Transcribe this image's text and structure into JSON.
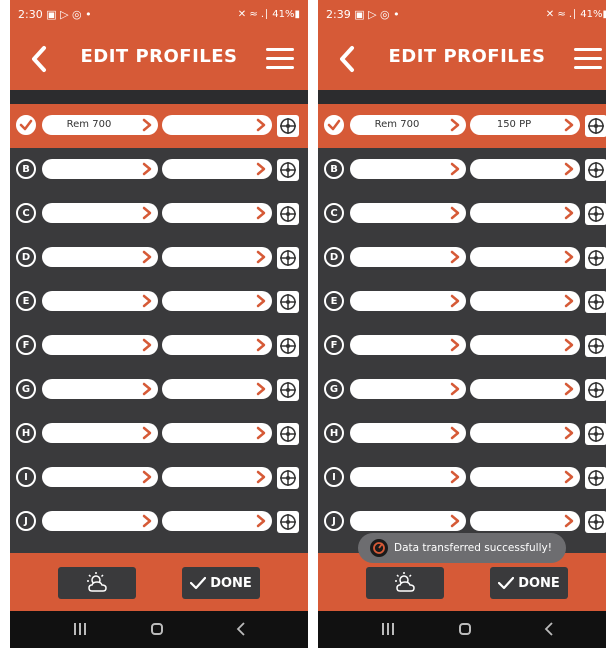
{
  "screens": [
    {
      "status_time": "2:30",
      "status_icons": "▣ ▷ ◎ •",
      "status_right": "✕ ≈ .∣ 41%▮",
      "title": "EDIT PROFILES",
      "rows": [
        {
          "badge": "",
          "selected": true,
          "field1": "Rem 700",
          "field2": ""
        },
        {
          "badge": "B",
          "selected": false,
          "field1": "",
          "field2": ""
        },
        {
          "badge": "C",
          "selected": false,
          "field1": "",
          "field2": ""
        },
        {
          "badge": "D",
          "selected": false,
          "field1": "",
          "field2": ""
        },
        {
          "badge": "E",
          "selected": false,
          "field1": "",
          "field2": ""
        },
        {
          "badge": "F",
          "selected": false,
          "field1": "",
          "field2": ""
        },
        {
          "badge": "G",
          "selected": false,
          "field1": "",
          "field2": ""
        },
        {
          "badge": "H",
          "selected": false,
          "field1": "",
          "field2": ""
        },
        {
          "badge": "I",
          "selected": false,
          "field1": "",
          "field2": ""
        },
        {
          "badge": "J",
          "selected": false,
          "field1": "",
          "field2": ""
        }
      ],
      "done_label": "DONE",
      "toast": null
    },
    {
      "status_time": "2:39",
      "status_icons": "▣ ▷ ◎ •",
      "status_right": "✕ ≈ .∣ 41%▮",
      "title": "EDIT PROFILES",
      "rows": [
        {
          "badge": "",
          "selected": true,
          "field1": "Rem 700",
          "field2": "150 PP"
        },
        {
          "badge": "B",
          "selected": false,
          "field1": "",
          "field2": ""
        },
        {
          "badge": "C",
          "selected": false,
          "field1": "",
          "field2": ""
        },
        {
          "badge": "D",
          "selected": false,
          "field1": "",
          "field2": ""
        },
        {
          "badge": "E",
          "selected": false,
          "field1": "",
          "field2": ""
        },
        {
          "badge": "F",
          "selected": false,
          "field1": "",
          "field2": ""
        },
        {
          "badge": "G",
          "selected": false,
          "field1": "",
          "field2": ""
        },
        {
          "badge": "H",
          "selected": false,
          "field1": "",
          "field2": ""
        },
        {
          "badge": "I",
          "selected": false,
          "field1": "",
          "field2": ""
        },
        {
          "badge": "J",
          "selected": false,
          "field1": "",
          "field2": ""
        }
      ],
      "done_label": "DONE",
      "toast": "Data transferred successfully!"
    }
  ],
  "icons": {
    "back": "chevron-left-icon",
    "menu": "hamburger-menu-icon",
    "selected": "checkmark-icon",
    "field_arrow": "chevron-right-icon",
    "target": "crosshair-target-icon",
    "weather": "sun-cloud-icon",
    "done": "checkmark-icon",
    "toast": "app-logo-icon",
    "nav_recent": "recent-apps-icon",
    "nav_home": "home-icon",
    "nav_back": "back-icon"
  },
  "colors": {
    "accent": "#d65a37",
    "panel": "#3a3a3c",
    "field": "#ffffff",
    "toast": "#6d6d70"
  }
}
